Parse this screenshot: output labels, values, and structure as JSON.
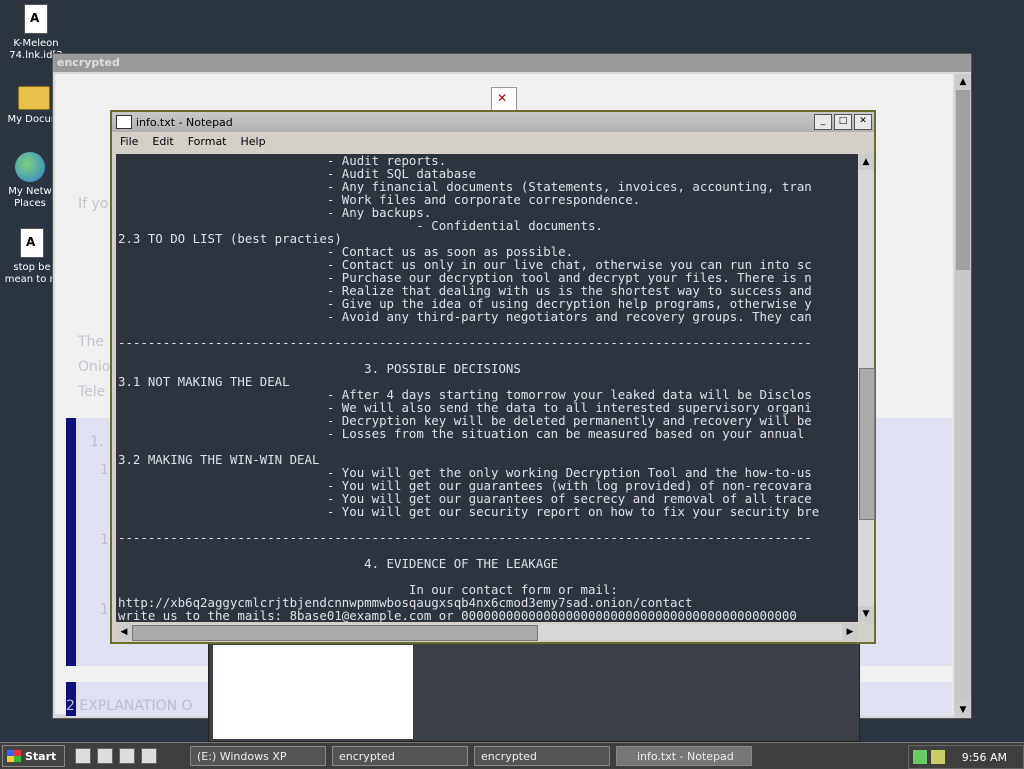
{
  "desktop": {
    "icons": [
      {
        "label": "K-Meleon\n74.lnk.id[2",
        "icon": "document-icon"
      },
      {
        "label": "My Docum",
        "icon": "folder-icon"
      },
      {
        "label": "My Netw\nPlaces",
        "icon": "network-icon"
      },
      {
        "label": "stop be\nmean to m",
        "icon": "document-icon"
      }
    ]
  },
  "bg_window": {
    "title": "encrypted",
    "fragments": [
      "If yo",
      "The",
      "Onio",
      "Tele",
      "1. ",
      "1",
      "1",
      "1",
      "2 EXPLANATION O"
    ]
  },
  "notepad": {
    "title": "info.txt - Notepad",
    "menu": [
      "File",
      "Edit",
      "Format",
      "Help"
    ],
    "lines": [
      "                            - Audit reports.",
      "                            - Audit SQL database",
      "                            - Any financial documents (Statements, invoices, accounting, tran",
      "                            - Work files and corporate correspondence.",
      "                            - Any backups.",
      "                                        - Confidential documents.",
      "2.3 TO DO LIST (best practies)",
      "                            - Contact us as soon as possible.",
      "                            - Contact us only in our live chat, otherwise you can run into sc",
      "                            - Purchase our decryption tool and decrypt your files. There is n",
      "                            - Realize that dealing with us is the shortest way to success and",
      "                            - Give up the idea of using decryption help programs, otherwise y",
      "                            - Avoid any third-party negotiators and recovery groups. They can",
      "",
      "---------------------------------------------------------------------------------------------",
      "",
      "                                 3. POSSIBLE DECISIONS",
      "3.1 NOT MAKING THE DEAL",
      "                            - After 4 days starting tomorrow your leaked data will be Disclos",
      "                            - We will also send the data to all interested supervisory organi",
      "                            - Decryption key will be deleted permanently and recovery will be",
      "                            - Losses from the situation can be measured based on your annual ",
      "",
      "3.2 MAKING THE WIN-WIN DEAL",
      "                            - You will get the only working Decryption Tool and the how-to-us",
      "                            - You will get our guarantees (with log provided) of non-recovara",
      "                            - You will get our guarantees of secrecy and removal of all trace",
      "                            - You will get our security report on how to fix your security bre",
      "",
      "---------------------------------------------------------------------------------------------",
      "",
      "                                 4. EVIDENCE OF THE LEAKAGE",
      "",
      "                                       In our contact form or mail:",
      "http://xb6q2aggycmlcrjtbjendcnnwpmmwbosqaugxsqb4nx6cmod3emy7sad.onion/contact",
      "write us to the mails: 8base01@example.com or 000000000000000000000000000000000000000000000"
    ]
  },
  "taskbar": {
    "start_label": "Start",
    "tasks": [
      "(E:) Windows XP",
      "encrypted",
      "encrypted",
      "info.txt - Notepad"
    ],
    "clock": "9:56 AM"
  }
}
